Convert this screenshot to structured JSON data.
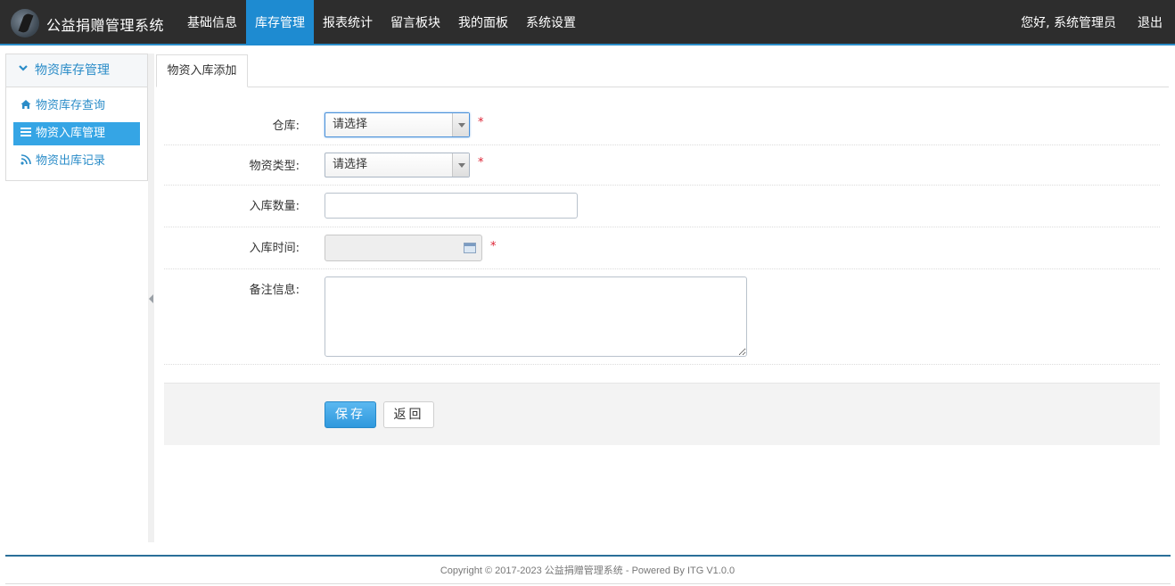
{
  "header": {
    "title": "公益捐赠管理系统",
    "nav": [
      "基础信息",
      "库存管理",
      "报表统计",
      "留言板块",
      "我的面板",
      "系统设置"
    ],
    "active_nav": "库存管理",
    "greeting": "您好, 系统管理员",
    "logout": "退出"
  },
  "sidebar": {
    "group": "物资库存管理",
    "items": [
      {
        "label": "物资库存查询",
        "icon": "home-icon"
      },
      {
        "label": "物资入库管理",
        "icon": "list-icon"
      },
      {
        "label": "物资出库记录",
        "icon": "rss-icon"
      }
    ],
    "active": "物资入库管理"
  },
  "tab": {
    "label": "物资入库添加"
  },
  "form": {
    "warehouse": {
      "label": "仓库:",
      "value": "请选择",
      "required": "*"
    },
    "type": {
      "label": "物资类型:",
      "value": "请选择",
      "required": "*"
    },
    "quantity": {
      "label": "入库数量:",
      "value": ""
    },
    "time": {
      "label": "入库时间:",
      "value": "",
      "required": "*"
    },
    "remark": {
      "label": "备注信息:",
      "value": ""
    }
  },
  "buttons": {
    "save": "保存",
    "back": "返回"
  },
  "footer": "Copyright © 2017-2023 公益捐赠管理系统 - Powered By ITG V1.0.0",
  "colors": {
    "accent": "#1e8bd1",
    "topbar": "#2d2d2d",
    "required": "#dd2233"
  }
}
